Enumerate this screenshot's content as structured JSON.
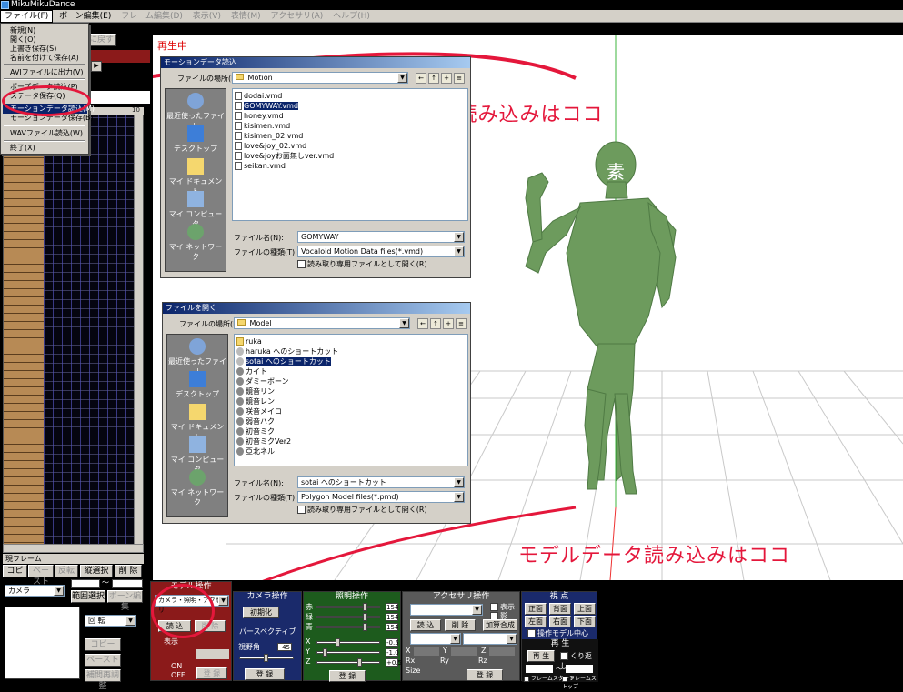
{
  "window": {
    "title": "MikuMikuDance"
  },
  "menubar": [
    "ファイル(F)",
    "ボーン編集(E)",
    "フレーム編集(D)",
    "表示(V)",
    "表情(M)",
    "アクセサリ(A)",
    "ヘルプ(H)"
  ],
  "file_menu": {
    "items": [
      "新規(N)",
      "開く(O)",
      "上書き保存(S)",
      "名前を付けて保存(A)",
      "AVIファイルに出力(V)",
      "ポーズデータ読込(P)",
      "ステータ保存(Q)",
      "モーションデータ読込(M)",
      "モーションデータ保存(B)",
      "WAVファイル読込(W)",
      "終了(X)"
    ],
    "highlighted": "モーションデータ読込(M)"
  },
  "left_panel": {
    "top_button": "元に戻す",
    "frame_header_numbers": [
      "0",
      "10"
    ],
    "current_frame_label": "現フレーム",
    "buttons": {
      "copy": "コピー",
      "paste": "ペースト",
      "reverse": "反転",
      "vertical_select": "縦選択",
      "delete": "削 除",
      "range_select": "範囲選択",
      "edit": "ボーン編集"
    },
    "range_sep": "〜",
    "model_select": "カメラ",
    "interp_select": "回 転",
    "side_buttons": [
      "コピー",
      "ペースト",
      "補間再調整"
    ]
  },
  "viewport": {
    "status": "再生中",
    "model_label": "素"
  },
  "motion_dialog": {
    "title": "モーションデータ読込",
    "location_label": "ファイルの場所(I):",
    "location": "Motion",
    "places": [
      "最近使ったファイル",
      "デスクトップ",
      "マイ ドキュメント",
      "マイ コンピュータ",
      "マイ ネットワーク"
    ],
    "files": [
      "dodai.vmd",
      "GOMYWAY.vmd",
      "honey.vmd",
      "kisimen.vmd",
      "kisimen_02.vmd",
      "love&joy_02.vmd",
      "love&joyお面無しver.vmd",
      "seikan.vmd"
    ],
    "selected_file": "GOMYWAY.vmd",
    "filename_label": "ファイル名(N):",
    "filename": "GOMYWAY",
    "filetype_label": "ファイルの種類(T):",
    "filetype": "Vocaloid Motion Data files(*.vmd)",
    "readonly_label": "読み取り専用ファイルとして開く(R)"
  },
  "model_dialog": {
    "title": "ファイルを開く",
    "location_label": "ファイルの場所(I):",
    "location": "Model",
    "places": [
      "最近使ったファイル",
      "デスクトップ",
      "マイ ドキュメント",
      "マイ コンピュータ",
      "マイ ネットワーク"
    ],
    "files": [
      "ruka",
      "haruka へのショートカット",
      "sotai へのショートカット",
      "カイト",
      "ダミーボーン",
      "鏡音リン",
      "鏡音レン",
      "咲音メイコ",
      "弱音ハク",
      "初音ミク",
      "初音ミクVer2",
      "亞北ネル"
    ],
    "selected_file": "sotai へのショートカット",
    "filename_label": "ファイル名(N):",
    "filename": "sotai へのショートカット",
    "filetype_label": "ファイルの種類(T):",
    "filetype": "Polygon Model files(*.pmd)",
    "readonly_label": "読み取り専用ファイルとして開く(R)"
  },
  "annotations": {
    "motion": "モーション読み込みはココ",
    "model": "モデルデータ読み込みはココ",
    "color": "#e4173b"
  },
  "model_panel": {
    "title": "モデル操作",
    "select": "カメラ・照明・アクセサリ",
    "load": "読 込",
    "delete": "削 除",
    "display": "表示",
    "on": "ON",
    "off": "OFF",
    "register": "登 録"
  },
  "camera_panel": {
    "title": "カメラ操作",
    "init": "初期化",
    "perspective": "パースペクティブ",
    "fov_label": "視野角",
    "fov": "45",
    "register": "登 録"
  },
  "light_panel": {
    "title": "照明操作",
    "channels": [
      "赤",
      "緑",
      "青"
    ],
    "rgb": [
      "154",
      "154",
      "154"
    ],
    "axes": [
      "X",
      "Y",
      "Z"
    ],
    "xyz": [
      "-0.5",
      "-1.0",
      "+0.5"
    ],
    "register": "登 録"
  },
  "accessory_panel": {
    "title": "アクセサリ操作",
    "show": "表示",
    "shadow": "影",
    "load": "読 込",
    "delete": "削 除",
    "add_blend": "加算合成",
    "coords": [
      "X",
      "Y",
      "Z",
      "Rx",
      "Ry",
      "Rz",
      "Size"
    ],
    "register": "登 録"
  },
  "view_panel": {
    "title": "視 点",
    "buttons": [
      "正面",
      "背面",
      "上面",
      "左面",
      "右面",
      "下面"
    ],
    "op_model": "操作モデル中心",
    "play_title": "再 生",
    "play": "再 生",
    "repeat": "くり返し",
    "range_sep": "〜",
    "frame_start": "フレームスタート",
    "frame_stop": "フレームストップ"
  }
}
